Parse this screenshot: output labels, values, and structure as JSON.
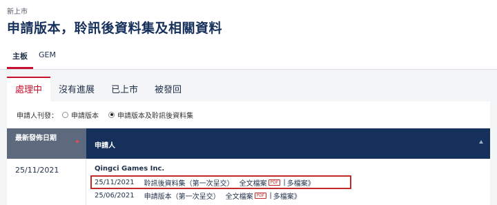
{
  "breadcrumb": "新上市",
  "page_title": "申請版本，聆訊後資料集及相關資料",
  "board_tabs": [
    "主板",
    "GEM"
  ],
  "status_tabs": [
    "處理中",
    "沒有進展",
    "已上市",
    "被發回"
  ],
  "filter": {
    "label": "申請人刊發：",
    "options": [
      "申請版本",
      "申請版本及聆訊後資料集"
    ],
    "selected": "申請版本及聆訊後資料集"
  },
  "table": {
    "headers": {
      "date": "最新發佈日期",
      "applicant": "申請人"
    },
    "rows": [
      {
        "date": "25/11/2021",
        "company": "Qingci Games Inc.",
        "documents": [
          {
            "date": "25/11/2021",
            "title": "聆訊後資料集（第一次呈交）",
            "full_doc": "全文檔案",
            "badge": "PDF",
            "multi": "多檔案",
            "arrow": "》",
            "highlighted": true
          },
          {
            "date": "25/06/2021",
            "title": "申請版本（第一次呈交）",
            "full_doc": "全文檔案",
            "badge": "PDF",
            "multi": "多檔案",
            "arrow": "》",
            "highlighted": false
          }
        ]
      }
    ]
  },
  "colors": {
    "accent": "#c8102e",
    "header_dark": "#16305c",
    "header_grey": "#5d6a7e",
    "highlight_box": "#c22a2a"
  }
}
